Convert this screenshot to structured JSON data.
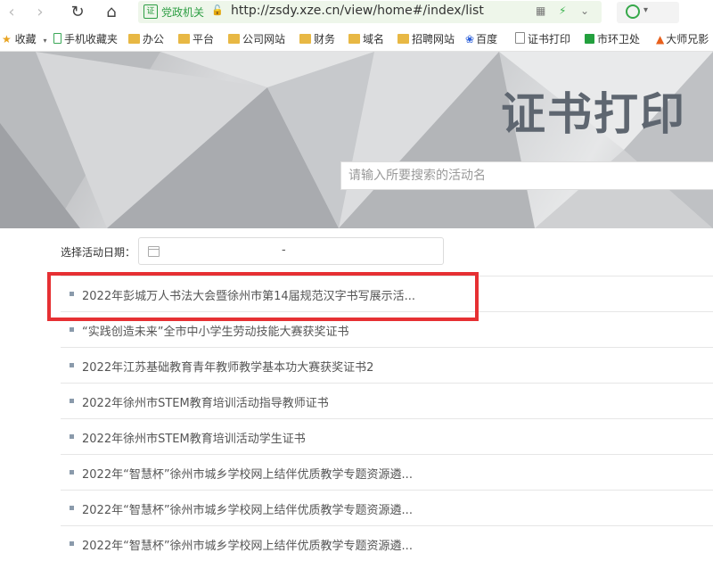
{
  "browser": {
    "site_name": "党政机关",
    "url": "http://zsdy.xze.cn/view/home#/index/list"
  },
  "bookmarks": [
    {
      "label": "收藏",
      "icon": "star-icon"
    },
    {
      "label": "手机收藏夹",
      "icon": "phone-icon"
    },
    {
      "label": "办公",
      "icon": "folder-icon"
    },
    {
      "label": "平台",
      "icon": "folder-icon"
    },
    {
      "label": "公司网站",
      "icon": "folder-icon"
    },
    {
      "label": "财务",
      "icon": "folder-icon"
    },
    {
      "label": "域名",
      "icon": "folder-icon"
    },
    {
      "label": "招聘网站",
      "icon": "folder-icon"
    },
    {
      "label": "百度",
      "icon": "baidu-paw-icon"
    },
    {
      "label": "证书打印",
      "icon": "page-icon"
    },
    {
      "label": "市环卫处",
      "icon": "green-grid-icon"
    },
    {
      "label": "大师兄影",
      "icon": "flame-icon"
    }
  ],
  "banner": {
    "title": "证书打印",
    "search_placeholder": "请输入所要搜索的活动名"
  },
  "filter": {
    "label": "选择活动日期：",
    "separator": "-"
  },
  "activities": [
    "2022年彭城万人书法大会暨徐州市第14届规范汉字书写展示活...",
    "“实践创造未来”全市中小学生劳动技能大赛获奖证书",
    "2022年江苏基础教育青年教师教学基本功大赛获奖证书2",
    "2022年徐州市STEM教育培训活动指导教师证书",
    "2022年徐州市STEM教育培训活动学生证书",
    "2022年“智慧杯”徐州市城乡学校网上结伴优质教学专题资源遴...",
    "2022年“智慧杯”徐州市城乡学校网上结伴优质教学专题资源遴...",
    "2022年“智慧杯”徐州市城乡学校网上结伴优质教学专题资源遴..."
  ],
  "colors": {
    "highlight": "#e63033",
    "title": "#5e6670"
  }
}
